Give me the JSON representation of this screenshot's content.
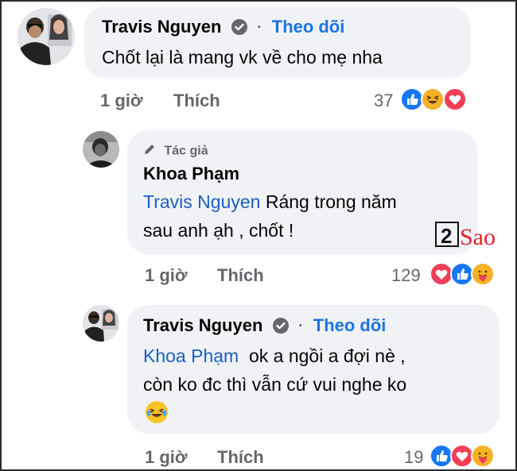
{
  "comments": [
    {
      "author": "Travis Nguyen",
      "follow_label": "Theo dõi",
      "dot": "·",
      "text": "Chốt lại là mang vk về cho mẹ nha",
      "time": "1 giờ",
      "like_label": "Thích",
      "reaction_count": "37",
      "reactions": [
        "like-icon",
        "haha-icon",
        "love-icon"
      ]
    },
    {
      "author_tag": "Tác giả",
      "author": "Khoa Phạm",
      "mention": "Travis Nguyen",
      "text_line1": " Ráng trong năm",
      "text_line2": "sau anh ạh , chốt !",
      "time": "1 giờ",
      "like_label": "Thích",
      "reaction_count": "129",
      "reactions": [
        "love-icon",
        "like-icon",
        "care-icon"
      ]
    },
    {
      "author": "Travis Nguyen",
      "follow_label": "Theo dõi",
      "dot": "·",
      "mention": "Khoa Phạm",
      "text_line1": "  ok a ngồi a đợi nè ,",
      "text_line2": "còn ko đc thì vẫn cứ vui nghe ko",
      "emoji": "laughing-tears-emoji",
      "time": "1 giờ",
      "like_label": "Thích",
      "reaction_count": "19",
      "reactions": [
        "like-icon",
        "love-icon",
        "care-icon"
      ]
    }
  ],
  "watermark": {
    "number": "2",
    "word": "Sao"
  },
  "colors": {
    "bubble": "#f0f2f5",
    "follow": "#1b74e4",
    "mention": "#1c5fbf",
    "meta": "#65676b",
    "like": "#1877f2",
    "love": "#f33e58",
    "haha": "#f7b125",
    "watermark": "#e0202b"
  }
}
